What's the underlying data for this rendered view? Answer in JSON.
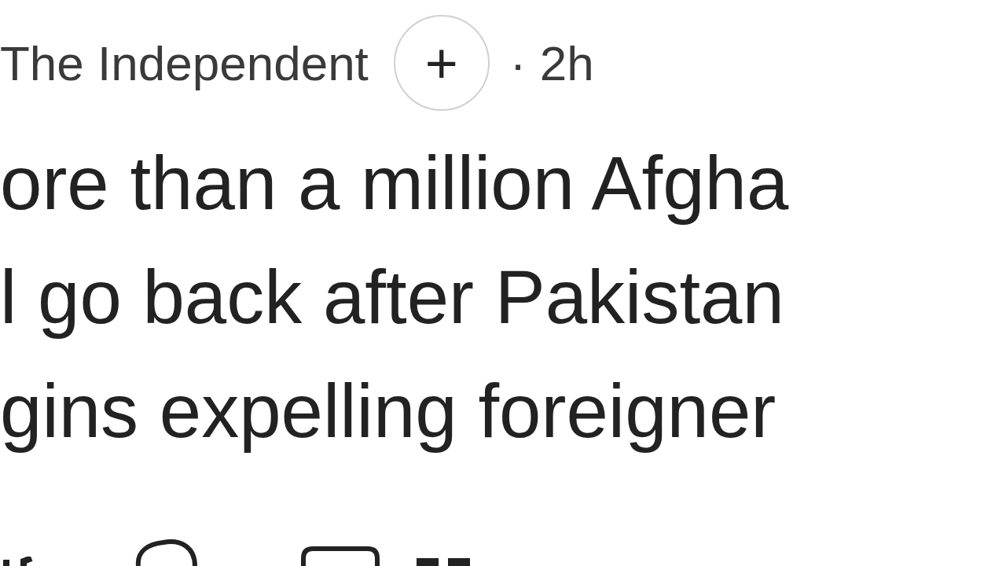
{
  "source": {
    "name": "The Independent",
    "follow": "+",
    "time": "· 2h"
  },
  "headline_lines": [
    "ore than a million Afgha",
    "l go back after Pakistan",
    "gins expelling foreigner"
  ]
}
